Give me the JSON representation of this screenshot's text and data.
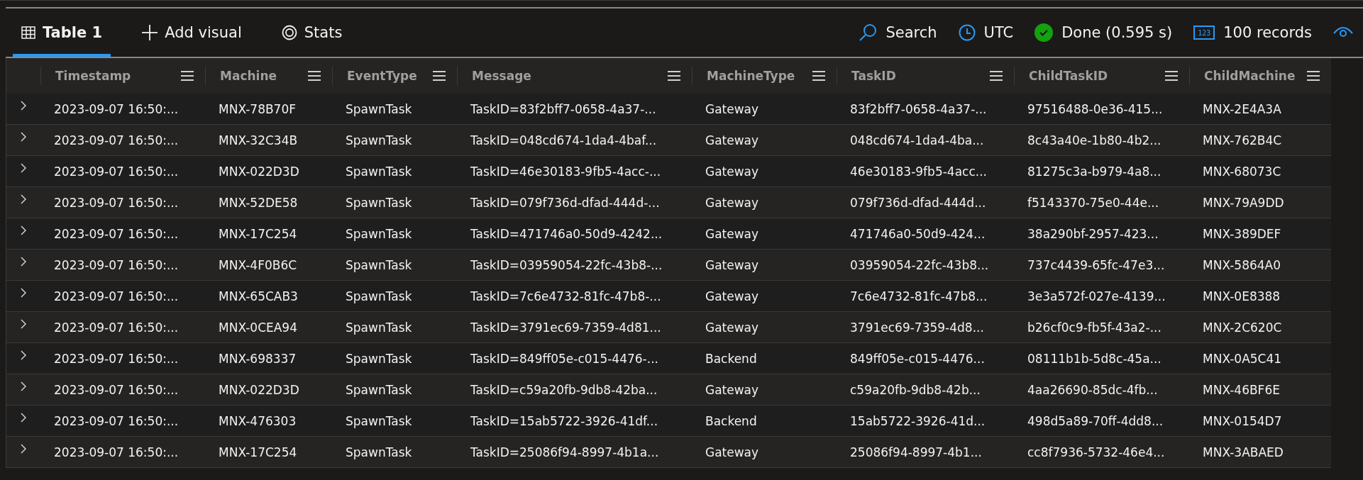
{
  "tabs": [
    {
      "label": "Table 1",
      "selected": true
    },
    {
      "label": "Add visual",
      "selected": false
    },
    {
      "label": "Stats",
      "selected": false
    }
  ],
  "status": {
    "search": "Search",
    "timezone": "UTC",
    "state": "Done (0.595 s)",
    "records_badge": "123",
    "records": "100 records"
  },
  "table": {
    "columns": [
      "Timestamp",
      "Machine",
      "EventType",
      "Message",
      "MachineType",
      "TaskID",
      "ChildTaskID",
      "ChildMachine"
    ],
    "rows": [
      {
        "expanded": false,
        "cells": [
          "2023-09-07 16:50:...",
          "MNX-78B70F",
          "SpawnTask",
          "TaskID=83f2bff7-0658-4a37-...",
          "Gateway",
          "83f2bff7-0658-4a37-...",
          "97516488-0e36-415...",
          "MNX-2E4A3A"
        ]
      },
      {
        "expanded": false,
        "cells": [
          "2023-09-07 16:50:...",
          "MNX-32C34B",
          "SpawnTask",
          "TaskID=048cd674-1da4-4baf...",
          "Gateway",
          "048cd674-1da4-4ba...",
          "8c43a40e-1b80-4b2...",
          "MNX-762B4C"
        ]
      },
      {
        "expanded": false,
        "cells": [
          "2023-09-07 16:50:...",
          "MNX-022D3D",
          "SpawnTask",
          "TaskID=46e30183-9fb5-4acc-...",
          "Gateway",
          "46e30183-9fb5-4acc...",
          "81275c3a-b979-4a8...",
          "MNX-68073C"
        ]
      },
      {
        "expanded": false,
        "cells": [
          "2023-09-07 16:50:...",
          "MNX-52DE58",
          "SpawnTask",
          "TaskID=079f736d-dfad-444d-...",
          "Gateway",
          "079f736d-dfad-444d...",
          "f5143370-75e0-44e...",
          "MNX-79A9DD"
        ]
      },
      {
        "expanded": false,
        "cells": [
          "2023-09-07 16:50:...",
          "MNX-17C254",
          "SpawnTask",
          "TaskID=471746a0-50d9-4242...",
          "Gateway",
          "471746a0-50d9-424...",
          "38a290bf-2957-423...",
          "MNX-389DEF"
        ]
      },
      {
        "expanded": false,
        "cells": [
          "2023-09-07 16:50:...",
          "MNX-4F0B6C",
          "SpawnTask",
          "TaskID=03959054-22fc-43b8-...",
          "Gateway",
          "03959054-22fc-43b8...",
          "737c4439-65fc-47e3...",
          "MNX-5864A0"
        ]
      },
      {
        "expanded": false,
        "cells": [
          "2023-09-07 16:50:...",
          "MNX-65CAB3",
          "SpawnTask",
          "TaskID=7c6e4732-81fc-47b8-...",
          "Gateway",
          "7c6e4732-81fc-47b8...",
          "3e3a572f-027e-4139...",
          "MNX-0E8388"
        ]
      },
      {
        "expanded": false,
        "cells": [
          "2023-09-07 16:50:...",
          "MNX-0CEA94",
          "SpawnTask",
          "TaskID=3791ec69-7359-4d81...",
          "Gateway",
          "3791ec69-7359-4d8...",
          "b26cf0c9-fb5f-43a2-...",
          "MNX-2C620C"
        ]
      },
      {
        "expanded": false,
        "cells": [
          "2023-09-07 16:50:...",
          "MNX-698337",
          "SpawnTask",
          "TaskID=849ff05e-c015-4476-...",
          "Backend",
          "849ff05e-c015-4476...",
          "08111b1b-5d8c-45a...",
          "MNX-0A5C41"
        ]
      },
      {
        "expanded": false,
        "cells": [
          "2023-09-07 16:50:...",
          "MNX-022D3D",
          "SpawnTask",
          "TaskID=c59a20fb-9db8-42ba...",
          "Gateway",
          "c59a20fb-9db8-42b...",
          "4aa26690-85dc-4fb...",
          "MNX-46BF6E"
        ]
      },
      {
        "expanded": false,
        "cells": [
          "2023-09-07 16:50:...",
          "MNX-476303",
          "SpawnTask",
          "TaskID=15ab5722-3926-41df...",
          "Backend",
          "15ab5722-3926-41d...",
          "498d5a89-70ff-4dd8...",
          "MNX-0154D7"
        ]
      },
      {
        "expanded": false,
        "cells": [
          "2023-09-07 16:50:...",
          "MNX-17C254",
          "SpawnTask",
          "TaskID=25086f94-8997-4b1a...",
          "Gateway",
          "25086f94-8997-4b1...",
          "cc8f7936-5732-46e4...",
          "MNX-3ABAED"
        ]
      }
    ]
  }
}
